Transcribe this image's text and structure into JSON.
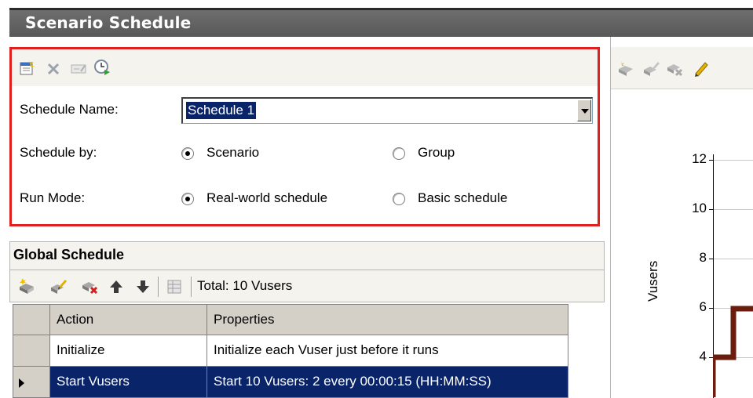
{
  "window": {
    "title": "Scenario Schedule"
  },
  "schedule": {
    "toolbar_icons": [
      "new-schedule-icon",
      "delete-icon",
      "rename-icon",
      "start-time-icon"
    ],
    "name_label": "Schedule Name:",
    "name_value": "Schedule 1",
    "schedule_by_label": "Schedule by:",
    "schedule_by_options": [
      "Scenario",
      "Group"
    ],
    "schedule_by_selected": "Scenario",
    "run_mode_label": "Run Mode:",
    "run_mode_options": [
      "Real-world schedule",
      "Basic schedule"
    ],
    "run_mode_selected": "Real-world schedule"
  },
  "global_schedule": {
    "title": "Global Schedule",
    "total_text": "Total: 10 Vusers",
    "toolbar_icons": [
      "add-action-icon",
      "edit-action-icon",
      "delete-action-icon",
      "move-up-icon",
      "move-down-icon",
      "grid-view-icon"
    ],
    "columns": [
      "Action",
      "Properties"
    ],
    "rows": [
      {
        "action": "Initialize",
        "properties": "Initialize each Vuser just before it runs",
        "selected": false
      },
      {
        "action": "Start  Vusers",
        "properties": "Start 10 Vusers: 2 every 00:00:15 (HH:MM:SS)",
        "selected": true
      }
    ]
  },
  "graph": {
    "toolbar_icons": [
      "graph-tool-1-icon",
      "graph-tool-2-icon",
      "graph-tool-3-icon",
      "pencil-icon"
    ],
    "ylabel": "Vusers",
    "y_ticks": [
      "12",
      "10",
      "8",
      "6",
      "4"
    ],
    "line_color": "#6b1e0e"
  }
}
